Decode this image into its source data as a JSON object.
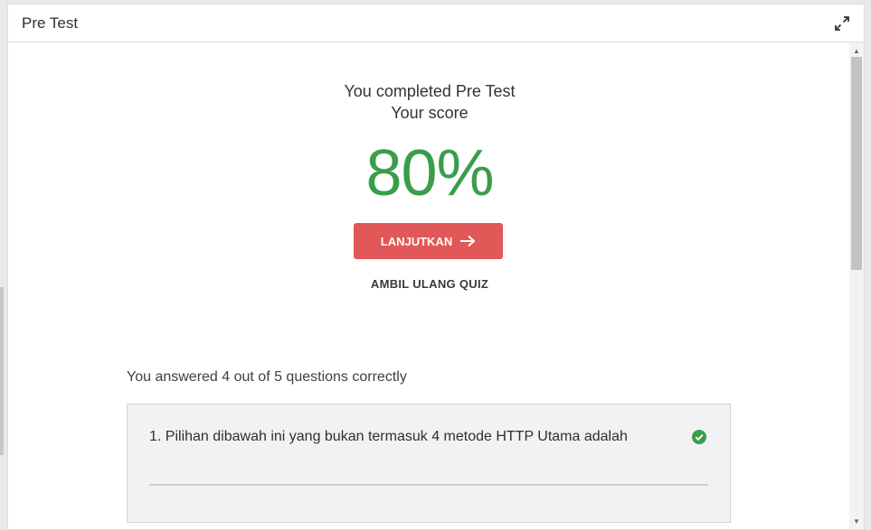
{
  "window": {
    "title": "Pre Test",
    "expand_icon": "expand-icon"
  },
  "result": {
    "line1": "You completed Pre Test",
    "line2": "Your score",
    "score": "80%",
    "continue_label": "LANJUTKAN",
    "continue_icon": "arrow-right-icon",
    "retake_label": "AMBIL ULANG QUIZ"
  },
  "summary": {
    "answered_text": "You answered 4 out of 5 questions correctly"
  },
  "questions": [
    {
      "text": "1. Pilihan dibawah ini yang bukan termasuk 4 metode HTTP Utama adalah",
      "status_icon": "check-circle-icon",
      "correct": true
    }
  ],
  "colors": {
    "score": "#3a9d4a",
    "button": "#e25757",
    "check": "#3a9d4a"
  }
}
